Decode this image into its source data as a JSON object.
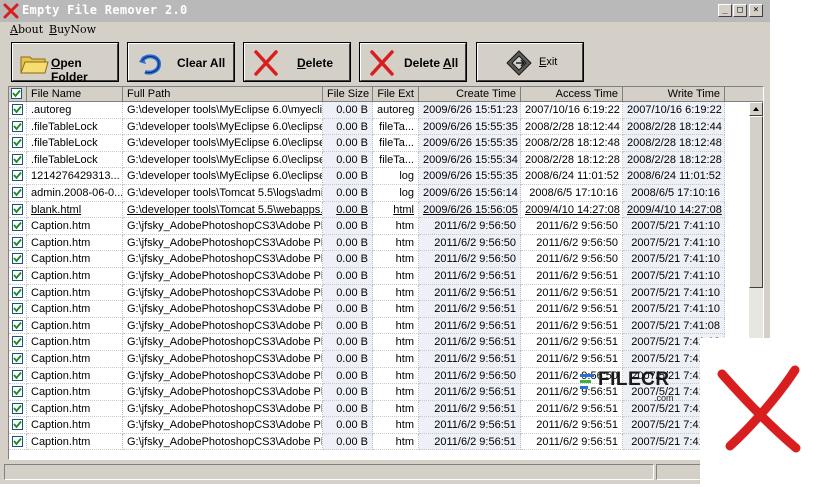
{
  "window": {
    "title": "Empty File Remover 2.0"
  },
  "menu": [
    {
      "label": "About",
      "underline": "A",
      "rest": "bout"
    },
    {
      "label": "BuyNow",
      "underline": "B",
      "rest": "uyNow"
    }
  ],
  "toolbar": {
    "open_folder": {
      "u": "O",
      "rest": "pen Folder",
      "icon": "folder-icon"
    },
    "clear_all": {
      "u": "",
      "rest": "Clear All",
      "icon": "undo-arrow-icon"
    },
    "delete": {
      "u": "D",
      "rest": "elete",
      "icon": "red-x-icon"
    },
    "delete_all": {
      "pre": "Delete ",
      "u": "A",
      "rest": "ll",
      "icon": "red-x-icon"
    },
    "exit": {
      "u": "E",
      "rest": "xit",
      "icon": "exit-diamond-icon"
    }
  },
  "columns": [
    "File Name",
    "Full Path",
    "File Size",
    "File Ext",
    "Create Time",
    "Access Time",
    "Write Time"
  ],
  "rows": [
    [
      ".autoreg",
      "G:\\developer tools\\MyEclipse 6.0\\myecli...",
      "0.00 B",
      "autoreg",
      "2009/6/26 15:51:23",
      "2007/10/16 6:19:22",
      "2007/10/16 6:19:22"
    ],
    [
      ".fileTableLock",
      "G:\\developer tools\\MyEclipse 6.0\\eclipse...",
      "0.00 B",
      "fileTa...",
      "2009/6/26 15:55:35",
      "2008/2/28 18:12:44",
      "2008/2/28 18:12:44"
    ],
    [
      ".fileTableLock",
      "G:\\developer tools\\MyEclipse 6.0\\eclipse...",
      "0.00 B",
      "fileTa...",
      "2009/6/26 15:55:35",
      "2008/2/28 18:12:48",
      "2008/2/28 18:12:48"
    ],
    [
      ".fileTableLock",
      "G:\\developer tools\\MyEclipse 6.0\\eclipse...",
      "0.00 B",
      "fileTa...",
      "2009/6/26 15:55:34",
      "2008/2/28 18:12:28",
      "2008/2/28 18:12:28"
    ],
    [
      "1214276429313...",
      "G:\\developer tools\\MyEclipse 6.0\\eclipse...",
      "0.00 B",
      "log",
      "2009/6/26 15:55:35",
      "2008/6/24 11:01:52",
      "2008/6/24 11:01:52"
    ],
    [
      "admin.2008-06-0...",
      "G:\\developer tools\\Tomcat 5.5\\logs\\admi...",
      "0.00 B",
      "log",
      "2009/6/26 15:56:14",
      "2008/6/5 17:10:16",
      "2008/6/5 17:10:16"
    ],
    [
      "blank.html",
      "G:\\developer tools\\Tomcat 5.5\\webapps...",
      "0.00 B",
      "html",
      "2009/6/26 15:56:05",
      "2009/4/10 14:27:08",
      "2009/4/10 14:27:08"
    ],
    [
      "Caption.htm",
      "G:\\jfsky_AdobePhotoshopCS3\\Adobe Ph...",
      "0.00 B",
      "htm",
      "2011/6/2 9:56:50",
      "2011/6/2 9:56:50",
      "2007/5/21 7:41:10"
    ],
    [
      "Caption.htm",
      "G:\\jfsky_AdobePhotoshopCS3\\Adobe Ph...",
      "0.00 B",
      "htm",
      "2011/6/2 9:56:50",
      "2011/6/2 9:56:50",
      "2007/5/21 7:41:10"
    ],
    [
      "Caption.htm",
      "G:\\jfsky_AdobePhotoshopCS3\\Adobe Ph...",
      "0.00 B",
      "htm",
      "2011/6/2 9:56:50",
      "2011/6/2 9:56:50",
      "2007/5/21 7:41:10"
    ],
    [
      "Caption.htm",
      "G:\\jfsky_AdobePhotoshopCS3\\Adobe Ph...",
      "0.00 B",
      "htm",
      "2011/6/2 9:56:51",
      "2011/6/2 9:56:51",
      "2007/5/21 7:41:10"
    ],
    [
      "Caption.htm",
      "G:\\jfsky_AdobePhotoshopCS3\\Adobe Ph...",
      "0.00 B",
      "htm",
      "2011/6/2 9:56:51",
      "2011/6/2 9:56:51",
      "2007/5/21 7:41:10"
    ],
    [
      "Caption.htm",
      "G:\\jfsky_AdobePhotoshopCS3\\Adobe Ph...",
      "0.00 B",
      "htm",
      "2011/6/2 9:56:51",
      "2011/6/2 9:56:51",
      "2007/5/21 7:41:10"
    ],
    [
      "Caption.htm",
      "G:\\jfsky_AdobePhotoshopCS3\\Adobe Ph...",
      "0.00 B",
      "htm",
      "2011/6/2 9:56:51",
      "2011/6/2 9:56:51",
      "2007/5/21 7:41:08"
    ],
    [
      "Caption.htm",
      "G:\\jfsky_AdobePhotoshopCS3\\Adobe Ph...",
      "0.00 B",
      "htm",
      "2011/6/2 9:56:51",
      "2011/6/2 9:56:51",
      "2007/5/21 7:41:10"
    ],
    [
      "Caption.htm",
      "G:\\jfsky_AdobePhotoshopCS3\\Adobe Ph...",
      "0.00 B",
      "htm",
      "2011/6/2 9:56:51",
      "2011/6/2 9:56:51",
      "2007/5/21 7:41:10"
    ],
    [
      "Caption.htm",
      "G:\\jfsky_AdobePhotoshopCS3\\Adobe Ph...",
      "0.00 B",
      "htm",
      "2011/6/2 9:56:50",
      "2011/6/2 9:56:50",
      "2007/5/21 7:41:10"
    ],
    [
      "Caption.htm",
      "G:\\jfsky_AdobePhotoshopCS3\\Adobe Ph...",
      "0.00 B",
      "htm",
      "2011/6/2 9:56:51",
      "2011/6/2 9:56:51",
      "2007/5/21 7:41:10"
    ],
    [
      "Caption.htm",
      "G:\\jfsky_AdobePhotoshopCS3\\Adobe Ph...",
      "0.00 B",
      "htm",
      "2011/6/2 9:56:51",
      "2011/6/2 9:56:51",
      "2007/5/21 7:41:10"
    ],
    [
      "Caption.htm",
      "G:\\jfsky_AdobePhotoshopCS3\\Adobe Ph...",
      "0.00 B",
      "htm",
      "2011/6/2 9:56:51",
      "2011/6/2 9:56:51",
      "2007/5/21 7:41:10"
    ],
    [
      "Caption.htm",
      "G:\\jfsky_AdobePhotoshopCS3\\Adobe Ph...",
      "0.00 B",
      "htm",
      "2011/6/2 9:56:51",
      "2011/6/2 9:56:51",
      "2007/5/21 7:41:10"
    ]
  ],
  "underlined_row": 6,
  "watermark": {
    "text": "FILECR",
    "sub": ".com"
  },
  "colors": {
    "title_bar": "#b9b9b9",
    "window_bg": "#d4d0c8",
    "x_red": "#d81e1e",
    "row_shade": "#eef0f8"
  }
}
